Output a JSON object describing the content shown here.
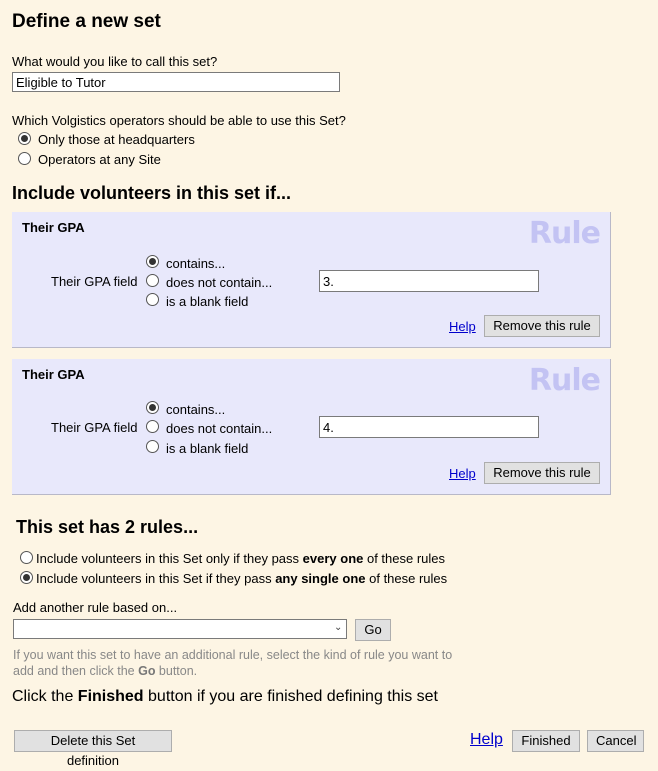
{
  "page": {
    "title": "Define a new set",
    "name_question": "What would you like to call this set?",
    "name_value": "Eligible to Tutor",
    "operators_question": "Which Volgistics operators should be able to use this Set?",
    "operator_options": [
      {
        "label": "Only those at headquarters",
        "selected": true
      },
      {
        "label": "Operators at any Site",
        "selected": false
      }
    ]
  },
  "rules_section": {
    "heading": "Include volunteers in this set if...",
    "watermark": "Rule",
    "rules": [
      {
        "title": "Their GPA",
        "field_label": "Their GPA field",
        "options": [
          {
            "label": "contains...",
            "selected": true
          },
          {
            "label": "does not contain...",
            "selected": false
          },
          {
            "label": "is a blank field",
            "selected": false
          }
        ],
        "value": "3.",
        "help_label": "Help",
        "remove_label": "Remove this rule"
      },
      {
        "title": "Their GPA",
        "field_label": "Their GPA field",
        "options": [
          {
            "label": "contains...",
            "selected": true
          },
          {
            "label": "does not contain...",
            "selected": false
          },
          {
            "label": "is a blank field",
            "selected": false
          }
        ],
        "value": "4.",
        "help_label": "Help",
        "remove_label": "Remove this rule"
      }
    ]
  },
  "combine": {
    "heading": "This set has 2 rules...",
    "options": [
      {
        "prefix": "Include volunteers in this Set only if they pass ",
        "bold": "every one",
        "suffix": " of these rules",
        "selected": false
      },
      {
        "prefix": "Include volunteers in this Set if they pass ",
        "bold": "any single one",
        "suffix": " of these rules",
        "selected": true
      }
    ]
  },
  "add_rule": {
    "label": "Add another rule based on...",
    "selected_value": "",
    "go_label": "Go",
    "hint_prefix": "If you want this set to have an additional rule, select the kind of rule you want to add and then click the ",
    "hint_bold": "Go",
    "hint_suffix": " button."
  },
  "footer": {
    "finish_prefix": "Click the ",
    "finish_bold": "Finished",
    "finish_suffix": " button if you are finished defining this set",
    "delete_label": "Delete this Set definition",
    "help_label": "Help",
    "finished_label": "Finished",
    "cancel_label": "Cancel"
  }
}
